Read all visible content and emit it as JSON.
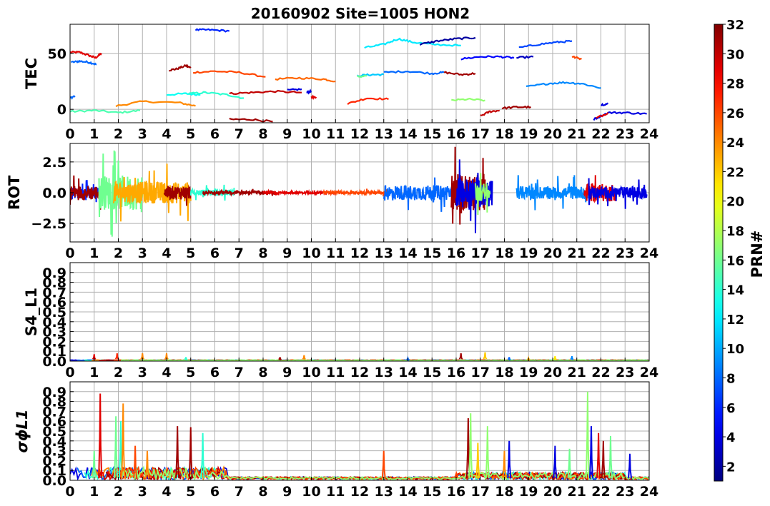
{
  "title": "20160902 Site=1005 HON2",
  "colorbar": {
    "label": "PRN#",
    "min": 1,
    "max": 32,
    "ticks": [
      2,
      4,
      6,
      8,
      10,
      12,
      14,
      16,
      18,
      20,
      22,
      24,
      26,
      28,
      30,
      32
    ]
  },
  "chart_data": [
    {
      "type": "line",
      "panel": "TEC",
      "ylabel": "TEC",
      "xlim": [
        0,
        24
      ],
      "ylim": [
        -12,
        76
      ],
      "xticks": [
        0,
        1,
        2,
        3,
        4,
        5,
        6,
        7,
        8,
        9,
        10,
        11,
        12,
        13,
        14,
        15,
        16,
        17,
        18,
        19,
        20,
        21,
        22,
        23,
        24
      ],
      "yticks": [
        0,
        50
      ],
      "ytick_labels": [
        "0",
        "50"
      ],
      "grid": true,
      "series": [
        {
          "prn": 29,
          "x": [
            0.0,
            0.4,
            0.8,
            1.05,
            1.3
          ],
          "y": [
            51,
            51,
            48,
            46,
            50
          ]
        },
        {
          "prn": 8,
          "x": [
            0.05,
            0.4,
            0.8,
            1.1
          ],
          "y": [
            42,
            43,
            42,
            40
          ]
        },
        {
          "prn": 8,
          "x": [
            0.0,
            0.2
          ],
          "y": [
            10,
            12
          ]
        },
        {
          "prn": 15,
          "x": [
            0.0,
            1.0,
            2.0,
            2.9
          ],
          "y": [
            -2,
            -1,
            -3,
            -1
          ]
        },
        {
          "prn": 24,
          "x": [
            1.9,
            3.0,
            4.5,
            5.2
          ],
          "y": [
            3,
            7,
            6,
            3
          ]
        },
        {
          "prn": 13,
          "x": [
            4.0,
            4.8,
            5.4
          ],
          "y": [
            13,
            14,
            13
          ]
        },
        {
          "prn": 31,
          "x": [
            4.1,
            4.4,
            4.8,
            5.0
          ],
          "y": [
            35,
            36,
            39,
            37
          ]
        },
        {
          "prn": 26,
          "x": [
            5.1,
            6.0,
            7.0,
            8.1
          ],
          "y": [
            33,
            34,
            33,
            29
          ]
        },
        {
          "prn": 6,
          "x": [
            5.2,
            5.8,
            6.6
          ],
          "y": [
            71,
            71,
            70
          ]
        },
        {
          "prn": 14,
          "x": [
            4.9,
            5.6,
            6.5,
            7.2
          ],
          "y": [
            14,
            15,
            13,
            10
          ]
        },
        {
          "prn": 30,
          "x": [
            6.6,
            7.5,
            8.5,
            9.6
          ],
          "y": [
            14,
            15,
            16,
            15
          ]
        },
        {
          "prn": 31,
          "x": [
            6.6,
            7.5,
            8.4
          ],
          "y": [
            -9,
            -9,
            -11
          ]
        },
        {
          "prn": 4,
          "x": [
            9.0,
            9.6
          ],
          "y": [
            17,
            18
          ]
        },
        {
          "prn": 4,
          "x": [
            9.8,
            10.0
          ],
          "y": [
            15,
            16
          ]
        },
        {
          "prn": 25,
          "x": [
            8.5,
            9.5,
            10.5,
            11.0
          ],
          "y": [
            27,
            28,
            27,
            25
          ]
        },
        {
          "prn": 29,
          "x": [
            10.0,
            10.2
          ],
          "y": [
            11,
            11
          ]
        },
        {
          "prn": 27,
          "x": [
            11.5,
            12.3,
            13.2
          ],
          "y": [
            5,
            10,
            9
          ]
        },
        {
          "prn": 11,
          "x": [
            11.9,
            12.5,
            13.0
          ],
          "y": [
            30,
            31,
            31
          ]
        },
        {
          "prn": 16,
          "x": [
            11.9,
            12.3
          ],
          "y": [
            29,
            30
          ]
        },
        {
          "prn": 12,
          "x": [
            12.2,
            13.0,
            13.6,
            14.2,
            15.0,
            16.2
          ],
          "y": [
            55,
            58,
            63,
            60,
            58,
            57
          ]
        },
        {
          "prn": 8,
          "x": [
            13.0,
            14.0,
            15.0,
            15.5
          ],
          "y": [
            33,
            34,
            32,
            33
          ]
        },
        {
          "prn": 31,
          "x": [
            15.5,
            16.2,
            16.8
          ],
          "y": [
            33,
            31,
            32
          ]
        },
        {
          "prn": 2,
          "x": [
            14.5,
            15.2,
            16.0,
            16.8
          ],
          "y": [
            58,
            61,
            63,
            64
          ]
        },
        {
          "prn": 5,
          "x": [
            16.2,
            17.0,
            17.8,
            18.4
          ],
          "y": [
            45,
            47,
            47,
            46
          ]
        },
        {
          "prn": 3,
          "x": [
            18.5,
            19.2
          ],
          "y": [
            46,
            47
          ]
        },
        {
          "prn": 17,
          "x": [
            15.8,
            16.5,
            17.2
          ],
          "y": [
            8,
            9,
            8
          ]
        },
        {
          "prn": 30,
          "x": [
            17.0,
            17.4,
            17.8
          ],
          "y": [
            -6,
            -2,
            -1
          ]
        },
        {
          "prn": 31,
          "x": [
            17.9,
            18.5,
            19.1
          ],
          "y": [
            1,
            2,
            2
          ]
        },
        {
          "prn": 7,
          "x": [
            18.6,
            19.4,
            20.2,
            20.8
          ],
          "y": [
            55,
            58,
            60,
            61
          ]
        },
        {
          "prn": 9,
          "x": [
            18.9,
            19.8,
            20.5,
            21.2,
            22.0
          ],
          "y": [
            20,
            23,
            24,
            23,
            19
          ]
        },
        {
          "prn": 26,
          "x": [
            20.8,
            21.2
          ],
          "y": [
            47,
            45
          ]
        },
        {
          "prn": 4,
          "x": [
            21.7,
            22.3,
            23.0,
            23.9
          ],
          "y": [
            -9,
            -3,
            -3,
            -4
          ]
        },
        {
          "prn": 29,
          "x": [
            21.8,
            22.3
          ],
          "y": [
            -8,
            -3
          ]
        },
        {
          "prn": 4,
          "x": [
            22.0,
            22.3
          ],
          "y": [
            4,
            5
          ]
        }
      ]
    },
    {
      "type": "line",
      "panel": "ROT",
      "ylabel": "ROT",
      "xlim": [
        0,
        24
      ],
      "ylim": [
        -4,
        4
      ],
      "yticks": [
        -2.5,
        0.0,
        2.5
      ],
      "ytick_labels": [
        "−2.5",
        "0.0",
        "2.5"
      ],
      "grid": true,
      "series": [
        {
          "prn": 6,
          "x": [
            0.0,
            0.4,
            0.8,
            1.2
          ],
          "amp": 1.2
        },
        {
          "prn": 31,
          "x": [
            0.0,
            0.6,
            1.3
          ],
          "amp": 1.5
        },
        {
          "prn": 16,
          "x": [
            1.2,
            1.8,
            2.4,
            3.0
          ],
          "amp": 3.5
        },
        {
          "prn": 23,
          "x": [
            1.8,
            3.0,
            4.2,
            5.0
          ],
          "amp": 2.2
        },
        {
          "prn": 31,
          "x": [
            3.9,
            4.5,
            5.0
          ],
          "amp": 1.4
        },
        {
          "prn": 14,
          "x": [
            5.0,
            5.8,
            6.8
          ],
          "amp": 0.6
        },
        {
          "prn": 31,
          "x": [
            5.5,
            7.0,
            8.5
          ],
          "amp": 0.3
        },
        {
          "prn": 29,
          "x": [
            8.0,
            9.5,
            11.0
          ],
          "amp": 0.2
        },
        {
          "prn": 26,
          "x": [
            10.5,
            12.0,
            13.2
          ],
          "amp": 0.3
        },
        {
          "prn": 8,
          "x": [
            13.0,
            14.5,
            16.0
          ],
          "amp": 1.5
        },
        {
          "prn": 31,
          "x": [
            15.8,
            16.5,
            17.2
          ],
          "amp": 3.6
        },
        {
          "prn": 4,
          "x": [
            16.0,
            16.8,
            17.5
          ],
          "amp": 3.0
        },
        {
          "prn": 17,
          "x": [
            16.8,
            17.4
          ],
          "amp": 2.0
        },
        {
          "prn": 9,
          "x": [
            18.5,
            19.5,
            20.5,
            21.5
          ],
          "amp": 1.3
        },
        {
          "prn": 29,
          "x": [
            21.3,
            22.0,
            22.6
          ],
          "amp": 1.8
        },
        {
          "prn": 4,
          "x": [
            21.5,
            22.5,
            23.9
          ],
          "amp": 1.2
        }
      ]
    },
    {
      "type": "line",
      "panel": "S4_L1",
      "ylabel": "S4_L1",
      "xlim": [
        0,
        24
      ],
      "ylim": [
        0,
        1
      ],
      "yticks": [
        0.0,
        0.1,
        0.2,
        0.3,
        0.4,
        0.5,
        0.6,
        0.7,
        0.8,
        0.9
      ],
      "ytick_labels": [
        "0.0",
        "0.1",
        "0.2",
        "0.3",
        "0.4",
        "0.5",
        "0.6",
        "0.7",
        "0.8",
        "0.9"
      ],
      "grid": true,
      "spikes": [
        {
          "prn": 29,
          "x": 1.0,
          "y": 0.07
        },
        {
          "prn": 27,
          "x": 1.95,
          "y": 0.08
        },
        {
          "prn": 24,
          "x": 3.0,
          "y": 0.08
        },
        {
          "prn": 24,
          "x": 4.0,
          "y": 0.08
        },
        {
          "prn": 14,
          "x": 4.8,
          "y": 0.04
        },
        {
          "prn": 31,
          "x": 8.7,
          "y": 0.04
        },
        {
          "prn": 24,
          "x": 9.7,
          "y": 0.06
        },
        {
          "prn": 8,
          "x": 14.0,
          "y": 0.03
        },
        {
          "prn": 31,
          "x": 16.2,
          "y": 0.08
        },
        {
          "prn": 22,
          "x": 17.2,
          "y": 0.09
        },
        {
          "prn": 8,
          "x": 18.2,
          "y": 0.04
        },
        {
          "prn": 23,
          "x": 19.0,
          "y": 0.03
        },
        {
          "prn": 9,
          "x": 20.8,
          "y": 0.05
        },
        {
          "prn": 21,
          "x": 20.1,
          "y": 0.05
        }
      ]
    },
    {
      "type": "line",
      "panel": "sigma_phi_L1",
      "ylabel": "σϕL1",
      "xlim": [
        0,
        24
      ],
      "ylim": [
        0,
        1
      ],
      "yticks": [
        0.0,
        0.1,
        0.2,
        0.3,
        0.4,
        0.5,
        0.6,
        0.7,
        0.8,
        0.9
      ],
      "ytick_labels": [
        "0.0",
        "0.1",
        "0.2",
        "0.3",
        "0.4",
        "0.5",
        "0.6",
        "0.7",
        "0.8",
        "0.9"
      ],
      "grid": true,
      "spikes": [
        {
          "prn": 29,
          "x": 1.25,
          "y": 0.88
        },
        {
          "prn": 16,
          "x": 1.0,
          "y": 0.3
        },
        {
          "prn": 16,
          "x": 1.9,
          "y": 0.65
        },
        {
          "prn": 14,
          "x": 2.1,
          "y": 0.6
        },
        {
          "prn": 24,
          "x": 2.2,
          "y": 0.78
        },
        {
          "prn": 26,
          "x": 2.7,
          "y": 0.35
        },
        {
          "prn": 24,
          "x": 3.2,
          "y": 0.3
        },
        {
          "prn": 31,
          "x": 4.45,
          "y": 0.55
        },
        {
          "prn": 31,
          "x": 5.0,
          "y": 0.54
        },
        {
          "prn": 14,
          "x": 5.5,
          "y": 0.48
        },
        {
          "prn": 26,
          "x": 13.0,
          "y": 0.3
        },
        {
          "prn": 31,
          "x": 16.5,
          "y": 0.63
        },
        {
          "prn": 17,
          "x": 16.6,
          "y": 0.68
        },
        {
          "prn": 22,
          "x": 16.9,
          "y": 0.38
        },
        {
          "prn": 17,
          "x": 17.3,
          "y": 0.55
        },
        {
          "prn": 4,
          "x": 18.2,
          "y": 0.4
        },
        {
          "prn": 24,
          "x": 18.0,
          "y": 0.3
        },
        {
          "prn": 4,
          "x": 20.1,
          "y": 0.35
        },
        {
          "prn": 16,
          "x": 20.7,
          "y": 0.32
        },
        {
          "prn": 17,
          "x": 21.45,
          "y": 0.9
        },
        {
          "prn": 4,
          "x": 21.6,
          "y": 0.55
        },
        {
          "prn": 29,
          "x": 21.9,
          "y": 0.48
        },
        {
          "prn": 31,
          "x": 22.1,
          "y": 0.4
        },
        {
          "prn": 16,
          "x": 22.4,
          "y": 0.45
        },
        {
          "prn": 4,
          "x": 23.2,
          "y": 0.27
        }
      ]
    }
  ]
}
